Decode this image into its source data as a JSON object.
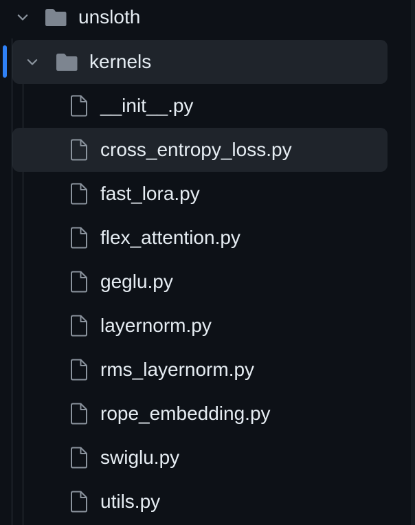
{
  "tree": {
    "root_folder": {
      "name": "unsloth",
      "icon": "folder-icon",
      "expanded": true
    },
    "sub_folder": {
      "name": "kernels",
      "icon": "folder-icon",
      "expanded": true,
      "selected": true
    },
    "files": [
      {
        "name": "__init__.py",
        "icon": "file-icon"
      },
      {
        "name": "cross_entropy_loss.py",
        "icon": "file-icon",
        "hovered": true
      },
      {
        "name": "fast_lora.py",
        "icon": "file-icon"
      },
      {
        "name": "flex_attention.py",
        "icon": "file-icon"
      },
      {
        "name": "geglu.py",
        "icon": "file-icon"
      },
      {
        "name": "layernorm.py",
        "icon": "file-icon"
      },
      {
        "name": "rms_layernorm.py",
        "icon": "file-icon"
      },
      {
        "name": "rope_embedding.py",
        "icon": "file-icon"
      },
      {
        "name": "swiglu.py",
        "icon": "file-icon"
      },
      {
        "name": "utils.py",
        "icon": "file-icon"
      }
    ]
  },
  "colors": {
    "background": "#0d1117",
    "text": "#e6edf3",
    "icon": "#8b949e",
    "folder_icon": "#7d8590",
    "row_highlight": "#1f242b",
    "active_indicator": "#2f81f7",
    "guide_line": "#30363d"
  }
}
